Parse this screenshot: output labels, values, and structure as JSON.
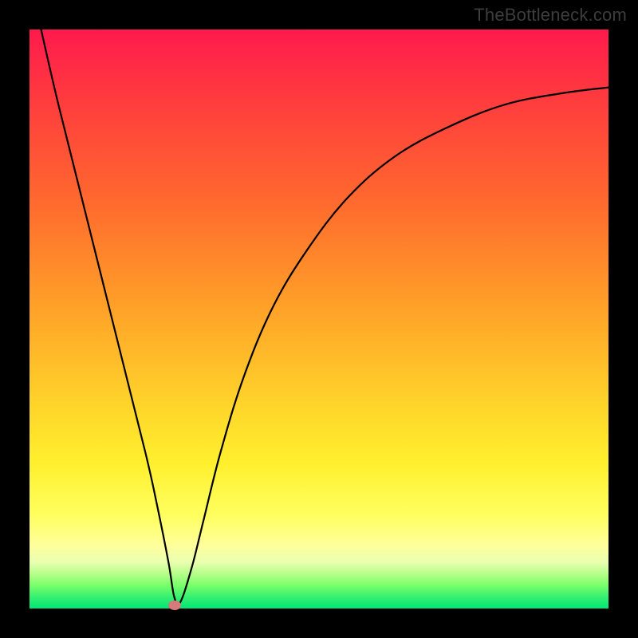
{
  "watermark": "TheBottleneck.com",
  "chart_data": {
    "type": "line",
    "title": "",
    "xlabel": "",
    "ylabel": "",
    "xlim": [
      0,
      100
    ],
    "ylim": [
      0,
      100
    ],
    "background_gradient": {
      "stops": [
        {
          "pos": 0,
          "color": "#ff1a4d"
        },
        {
          "pos": 30,
          "color": "#ff6a2e"
        },
        {
          "pos": 64,
          "color": "#ffd22a"
        },
        {
          "pos": 84,
          "color": "#ffff60"
        },
        {
          "pos": 96,
          "color": "#7aff6a"
        },
        {
          "pos": 100,
          "color": "#00e676"
        }
      ]
    },
    "series": [
      {
        "name": "bottleneck-curve",
        "color": "#000000",
        "x": [
          2,
          5,
          10,
          15,
          20,
          22,
          24,
          25,
          26,
          28,
          30,
          33,
          37,
          42,
          48,
          55,
          63,
          72,
          82,
          92,
          100
        ],
        "values": [
          100,
          87,
          67,
          47,
          27,
          18,
          8,
          2,
          1,
          7,
          15,
          27,
          40,
          52,
          62,
          71,
          78,
          83,
          87,
          89,
          90
        ]
      }
    ],
    "markers": [
      {
        "name": "optimal-point",
        "x": 25,
        "y": 0.5,
        "color": "#d87a7a"
      }
    ],
    "grid": false,
    "legend": false
  },
  "colors": {
    "frame": "#000000",
    "curve": "#000000",
    "marker": "#d87a7a"
  }
}
